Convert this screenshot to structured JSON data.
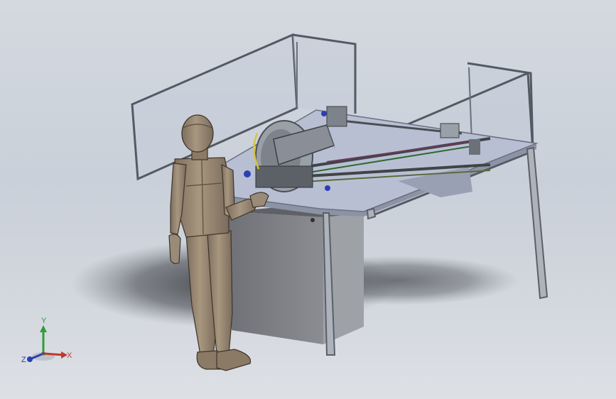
{
  "viewport": {
    "background_top": "#d4d9e0",
    "background_bottom": "#dde0e5"
  },
  "triad": {
    "x_label": "X",
    "y_label": "Y",
    "z_label": "Z",
    "x_color": "#c0392b",
    "y_color": "#2e9e3a",
    "z_color": "#2b3fb5"
  },
  "colors": {
    "frame_metal": "#8c9198",
    "table_top": "#b9bfd3",
    "cabinet": "#7d7f83",
    "guard_glass": "#c4c9d6",
    "mannequin": "#9a8a78",
    "saw_body": "#8a8f97"
  }
}
